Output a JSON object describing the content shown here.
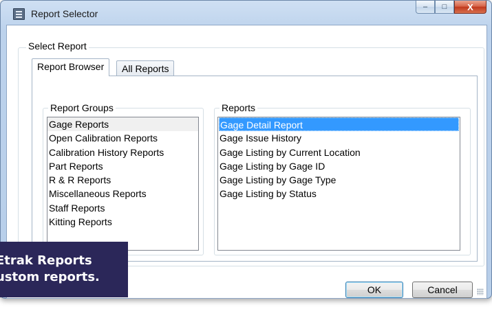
{
  "window": {
    "title": "Report Selector",
    "controls": {
      "minimize": "–",
      "maximize": "□",
      "close": "X"
    }
  },
  "select_report": {
    "legend": "Select Report",
    "tabs": [
      {
        "label": "Report Browser",
        "active": true
      },
      {
        "label": "All Reports",
        "active": false
      }
    ],
    "report_groups": {
      "legend": "Report Groups",
      "items": [
        "Gage Reports",
        "Open Calibration Reports",
        "Calibration History Reports",
        "Part Reports",
        "R & R Reports",
        "Miscellaneous Reports",
        "Staff Reports",
        "Kitting Reports"
      ],
      "highlighted": "Gage Reports"
    },
    "reports": {
      "legend": "Reports",
      "items": [
        "Gage Detail Report",
        "Gage Issue History",
        "Gage Listing by Current Location",
        "Gage Listing by Gage ID",
        "Gage Listing by Gage Type",
        "Gage Listing by Status"
      ],
      "selected": "Gage Detail Report"
    }
  },
  "buttons": {
    "ok": "OK",
    "cancel": "Cancel"
  },
  "overlay": {
    "line1": "Etrak Reports",
    "line2": "ustom reports."
  },
  "colors": {
    "selection": "#3399ff",
    "overlay_bg": "#2b2759",
    "close_button": "#c0391e"
  }
}
